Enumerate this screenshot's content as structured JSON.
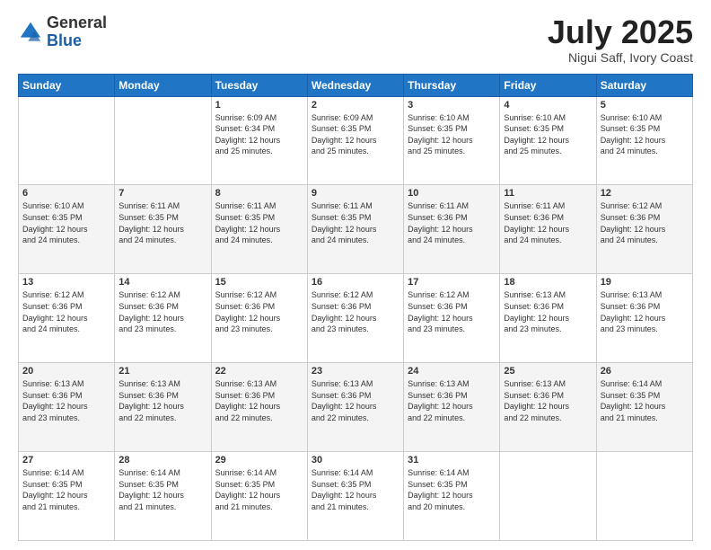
{
  "header": {
    "logo_general": "General",
    "logo_blue": "Blue",
    "month": "July 2025",
    "location": "Nigui Saff, Ivory Coast"
  },
  "days_of_week": [
    "Sunday",
    "Monday",
    "Tuesday",
    "Wednesday",
    "Thursday",
    "Friday",
    "Saturday"
  ],
  "weeks": [
    [
      {
        "day": "",
        "info": ""
      },
      {
        "day": "",
        "info": ""
      },
      {
        "day": "1",
        "sunrise": "6:09 AM",
        "sunset": "6:34 PM",
        "daylight": "12 hours and 25 minutes."
      },
      {
        "day": "2",
        "sunrise": "6:09 AM",
        "sunset": "6:35 PM",
        "daylight": "12 hours and 25 minutes."
      },
      {
        "day": "3",
        "sunrise": "6:10 AM",
        "sunset": "6:35 PM",
        "daylight": "12 hours and 25 minutes."
      },
      {
        "day": "4",
        "sunrise": "6:10 AM",
        "sunset": "6:35 PM",
        "daylight": "12 hours and 25 minutes."
      },
      {
        "day": "5",
        "sunrise": "6:10 AM",
        "sunset": "6:35 PM",
        "daylight": "12 hours and 24 minutes."
      }
    ],
    [
      {
        "day": "6",
        "sunrise": "6:10 AM",
        "sunset": "6:35 PM",
        "daylight": "12 hours and 24 minutes."
      },
      {
        "day": "7",
        "sunrise": "6:11 AM",
        "sunset": "6:35 PM",
        "daylight": "12 hours and 24 minutes."
      },
      {
        "day": "8",
        "sunrise": "6:11 AM",
        "sunset": "6:35 PM",
        "daylight": "12 hours and 24 minutes."
      },
      {
        "day": "9",
        "sunrise": "6:11 AM",
        "sunset": "6:35 PM",
        "daylight": "12 hours and 24 minutes."
      },
      {
        "day": "10",
        "sunrise": "6:11 AM",
        "sunset": "6:36 PM",
        "daylight": "12 hours and 24 minutes."
      },
      {
        "day": "11",
        "sunrise": "6:11 AM",
        "sunset": "6:36 PM",
        "daylight": "12 hours and 24 minutes."
      },
      {
        "day": "12",
        "sunrise": "6:12 AM",
        "sunset": "6:36 PM",
        "daylight": "12 hours and 24 minutes."
      }
    ],
    [
      {
        "day": "13",
        "sunrise": "6:12 AM",
        "sunset": "6:36 PM",
        "daylight": "12 hours and 24 minutes."
      },
      {
        "day": "14",
        "sunrise": "6:12 AM",
        "sunset": "6:36 PM",
        "daylight": "12 hours and 23 minutes."
      },
      {
        "day": "15",
        "sunrise": "6:12 AM",
        "sunset": "6:36 PM",
        "daylight": "12 hours and 23 minutes."
      },
      {
        "day": "16",
        "sunrise": "6:12 AM",
        "sunset": "6:36 PM",
        "daylight": "12 hours and 23 minutes."
      },
      {
        "day": "17",
        "sunrise": "6:12 AM",
        "sunset": "6:36 PM",
        "daylight": "12 hours and 23 minutes."
      },
      {
        "day": "18",
        "sunrise": "6:13 AM",
        "sunset": "6:36 PM",
        "daylight": "12 hours and 23 minutes."
      },
      {
        "day": "19",
        "sunrise": "6:13 AM",
        "sunset": "6:36 PM",
        "daylight": "12 hours and 23 minutes."
      }
    ],
    [
      {
        "day": "20",
        "sunrise": "6:13 AM",
        "sunset": "6:36 PM",
        "daylight": "12 hours and 23 minutes."
      },
      {
        "day": "21",
        "sunrise": "6:13 AM",
        "sunset": "6:36 PM",
        "daylight": "12 hours and 22 minutes."
      },
      {
        "day": "22",
        "sunrise": "6:13 AM",
        "sunset": "6:36 PM",
        "daylight": "12 hours and 22 minutes."
      },
      {
        "day": "23",
        "sunrise": "6:13 AM",
        "sunset": "6:36 PM",
        "daylight": "12 hours and 22 minutes."
      },
      {
        "day": "24",
        "sunrise": "6:13 AM",
        "sunset": "6:36 PM",
        "daylight": "12 hours and 22 minutes."
      },
      {
        "day": "25",
        "sunrise": "6:13 AM",
        "sunset": "6:36 PM",
        "daylight": "12 hours and 22 minutes."
      },
      {
        "day": "26",
        "sunrise": "6:14 AM",
        "sunset": "6:35 PM",
        "daylight": "12 hours and 21 minutes."
      }
    ],
    [
      {
        "day": "27",
        "sunrise": "6:14 AM",
        "sunset": "6:35 PM",
        "daylight": "12 hours and 21 minutes."
      },
      {
        "day": "28",
        "sunrise": "6:14 AM",
        "sunset": "6:35 PM",
        "daylight": "12 hours and 21 minutes."
      },
      {
        "day": "29",
        "sunrise": "6:14 AM",
        "sunset": "6:35 PM",
        "daylight": "12 hours and 21 minutes."
      },
      {
        "day": "30",
        "sunrise": "6:14 AM",
        "sunset": "6:35 PM",
        "daylight": "12 hours and 21 minutes."
      },
      {
        "day": "31",
        "sunrise": "6:14 AM",
        "sunset": "6:35 PM",
        "daylight": "12 hours and 20 minutes."
      },
      {
        "day": "",
        "info": ""
      },
      {
        "day": "",
        "info": ""
      }
    ]
  ]
}
